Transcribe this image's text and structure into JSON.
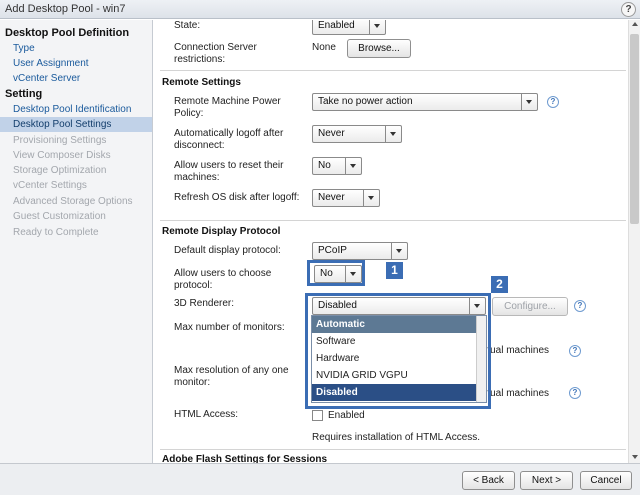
{
  "window": {
    "title": "Add Desktop Pool - win7",
    "help": "?"
  },
  "sidebar": {
    "sections": [
      {
        "title": "Desktop Pool Definition",
        "items": [
          {
            "label": "Type"
          },
          {
            "label": "User Assignment"
          },
          {
            "label": "vCenter Server"
          }
        ]
      },
      {
        "title": "Setting",
        "items": [
          {
            "label": "Desktop Pool Identification"
          },
          {
            "label": "Desktop Pool Settings"
          },
          {
            "label": "Provisioning Settings"
          },
          {
            "label": "View Composer Disks"
          },
          {
            "label": "Storage Optimization"
          },
          {
            "label": "vCenter Settings"
          },
          {
            "label": "Advanced Storage Options"
          },
          {
            "label": "Guest Customization"
          },
          {
            "label": "Ready to Complete"
          }
        ]
      }
    ]
  },
  "top": {
    "state_label": "State:",
    "state_value": "Enabled",
    "conn_label": "Connection Server restrictions:",
    "conn_value": "None",
    "browse_label": "Browse..."
  },
  "remote": {
    "title": "Remote Settings",
    "power_label": "Remote Machine Power Policy:",
    "power_value": "Take no power action",
    "logoff_label": "Automatically logoff after disconnect:",
    "logoff_value": "Never",
    "reset_label": "Allow users to reset their machines:",
    "reset_value": "No",
    "refresh_label": "Refresh OS disk after logoff:",
    "refresh_value": "Never"
  },
  "display": {
    "title": "Remote Display Protocol",
    "default_label": "Default display protocol:",
    "default_value": "PCoIP",
    "choose_label": "Allow users to choose protocol:",
    "choose_value": "No",
    "renderer_label": "3D Renderer:",
    "renderer_value": "Disabled",
    "configure_label": "Configure...",
    "monitors_label": "Max number of monitors:",
    "resolution_label": "Max resolution of any one monitor:",
    "partial_text_1": "rtual machines",
    "partial_text_2": "rtual machines",
    "html_label": "HTML Access:",
    "html_checkbox_label": "Enabled",
    "html_note": "Requires installation of HTML Access.",
    "renderer_options": [
      "Automatic",
      "Software",
      "Hardware",
      "NVIDIA GRID VGPU",
      "Disabled"
    ]
  },
  "flash": {
    "title": "Adobe Flash Settings for Sessions"
  },
  "callouts": {
    "one": "1",
    "two": "2"
  },
  "help_icon": "?",
  "footer": {
    "back_label": "< Back",
    "next_label": "Next >",
    "cancel_label": "Cancel"
  },
  "colors": {
    "highlight": "#3b6db4",
    "active_nav": "#c1d2e8",
    "dropdown_selected": "#2b4f86",
    "dropdown_hover": "#5d7994"
  }
}
